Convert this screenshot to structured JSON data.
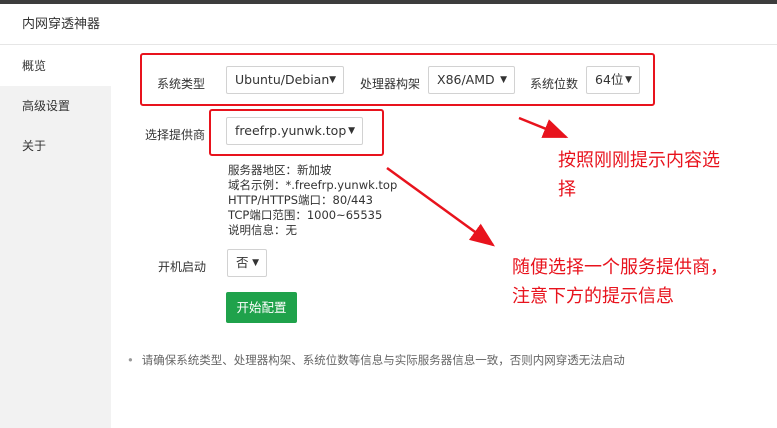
{
  "window": {
    "title": "内网穿透神器"
  },
  "sidebar": {
    "items": [
      {
        "label": "概览"
      },
      {
        "label": "高级设置"
      },
      {
        "label": "关于"
      }
    ]
  },
  "form": {
    "system_type_label": "系统类型",
    "system_type_value": "Ubuntu/Debian",
    "arch_label": "处理器构架",
    "arch_value": "X86/AMD",
    "bits_label": "系统位数",
    "bits_value": "64位",
    "provider_label": "选择提供商",
    "provider_value": "freefrp.yunwk.top",
    "provider_info": [
      "服务器地区：新加坡",
      "域名示例：*.freefrp.yunwk.top",
      "HTTP/HTTPS端口：80/443",
      "TCP端口范围：1000~65535",
      "说明信息：无"
    ],
    "autostart_label": "开机启动",
    "autostart_value": "否",
    "start_button": "开始配置"
  },
  "note": "请确保系统类型、处理器构架、系统位数等信息与实际服务器信息一致，否则内网穿透无法启动",
  "annotations": {
    "top_line1": "按照刚刚提示内容选",
    "top_line2": "择",
    "bottom_line1": "随便选择一个服务提供商，",
    "bottom_line2": "注意下方的提示信息"
  },
  "colors": {
    "accent_green": "#1fa24b",
    "annotation_red": "#e8131d"
  }
}
